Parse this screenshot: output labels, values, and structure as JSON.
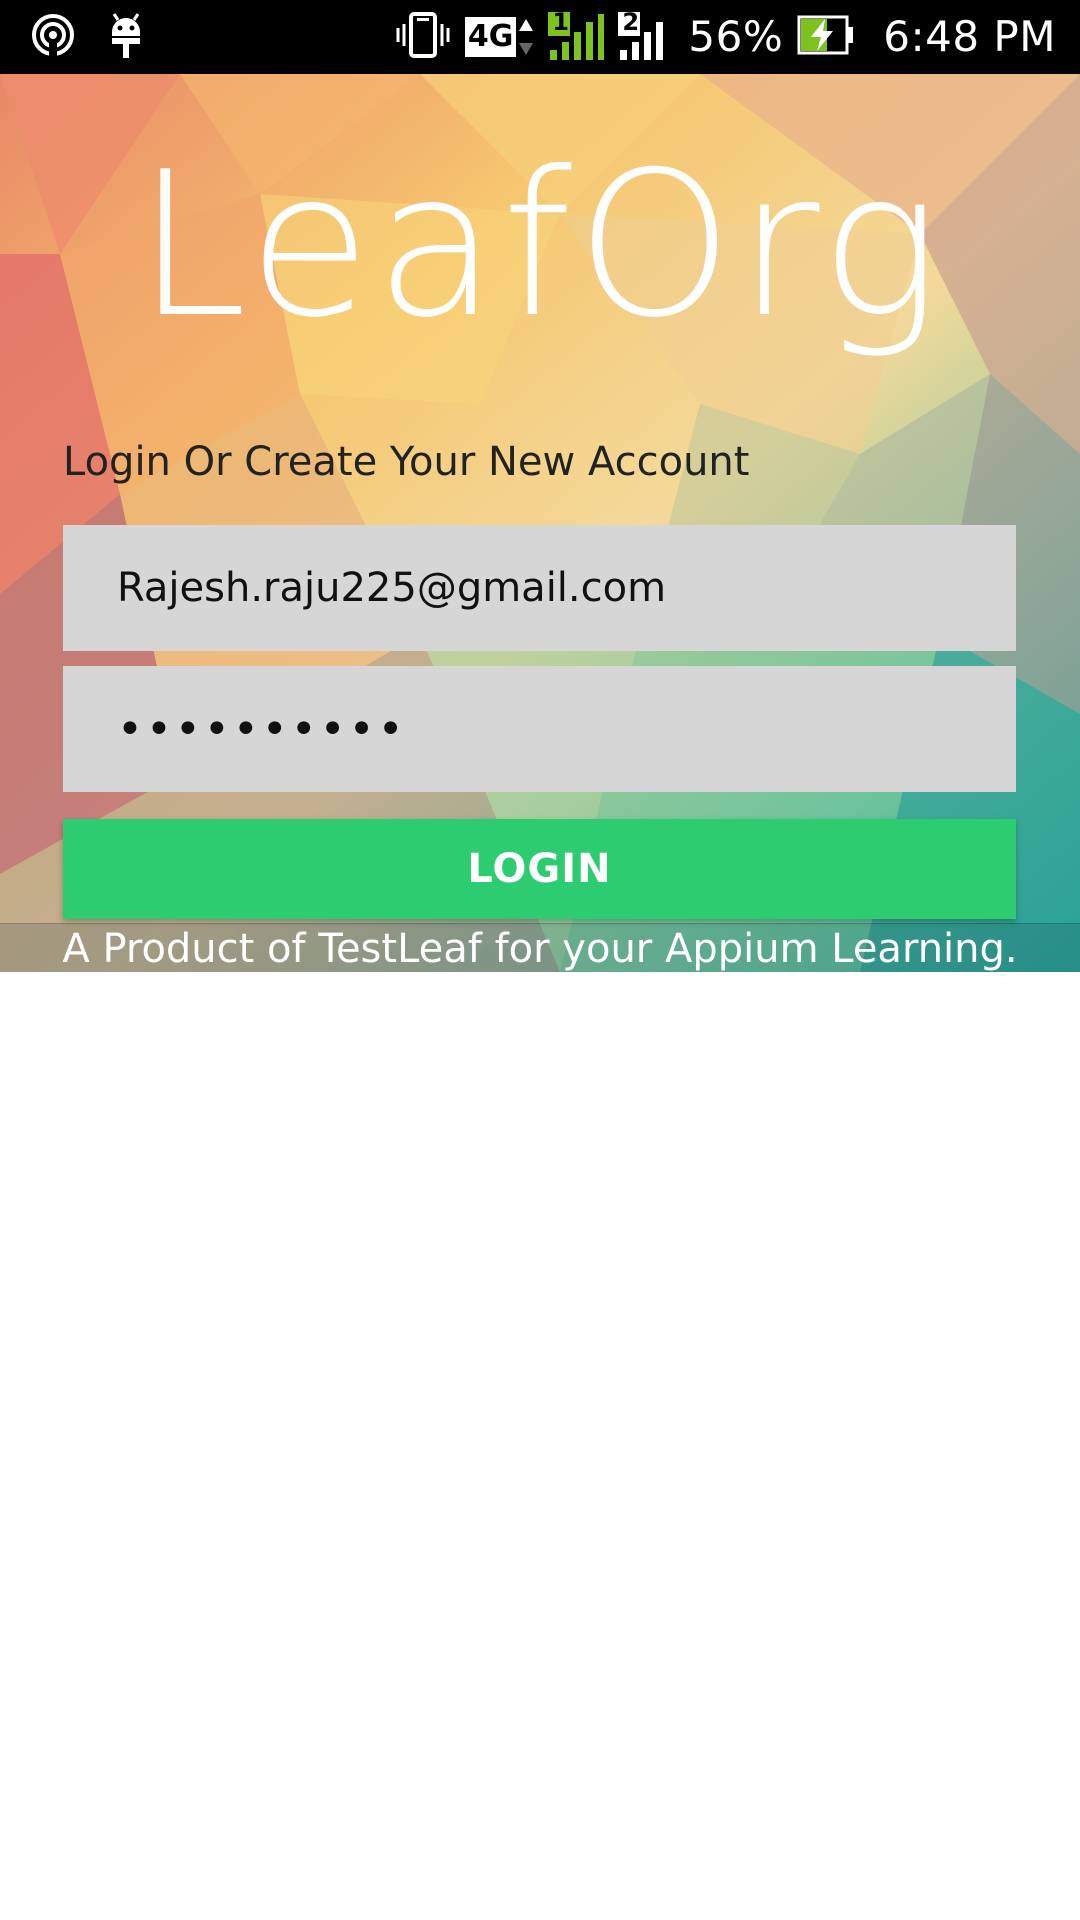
{
  "status_bar": {
    "icons": [
      "hotspot-icon",
      "android-debug-icon",
      "vibrate-icon",
      "network-4g-icon",
      "signal-sim1-icon",
      "signal-sim2-icon",
      "battery-charging-icon"
    ],
    "network_type": "4G",
    "sim1_label": "1",
    "sim2_label": "2",
    "battery_percent": "56%",
    "time": "6:48 PM",
    "colors": {
      "background": "#000000",
      "sim1_signal": "#7dc31f"
    }
  },
  "app": {
    "logo": "LeafOrg",
    "heading": "Login Or Create Your New Account",
    "email_value": "Rajesh.raju225@gmail.com",
    "password_value": "••••••••••",
    "login_label": "LOGIN",
    "footer": "A Product of TestLeaf for your Appium Learning.",
    "colors": {
      "button": "#2ecc71",
      "field": "#d6d6d6",
      "logo": "#ffffff"
    }
  }
}
